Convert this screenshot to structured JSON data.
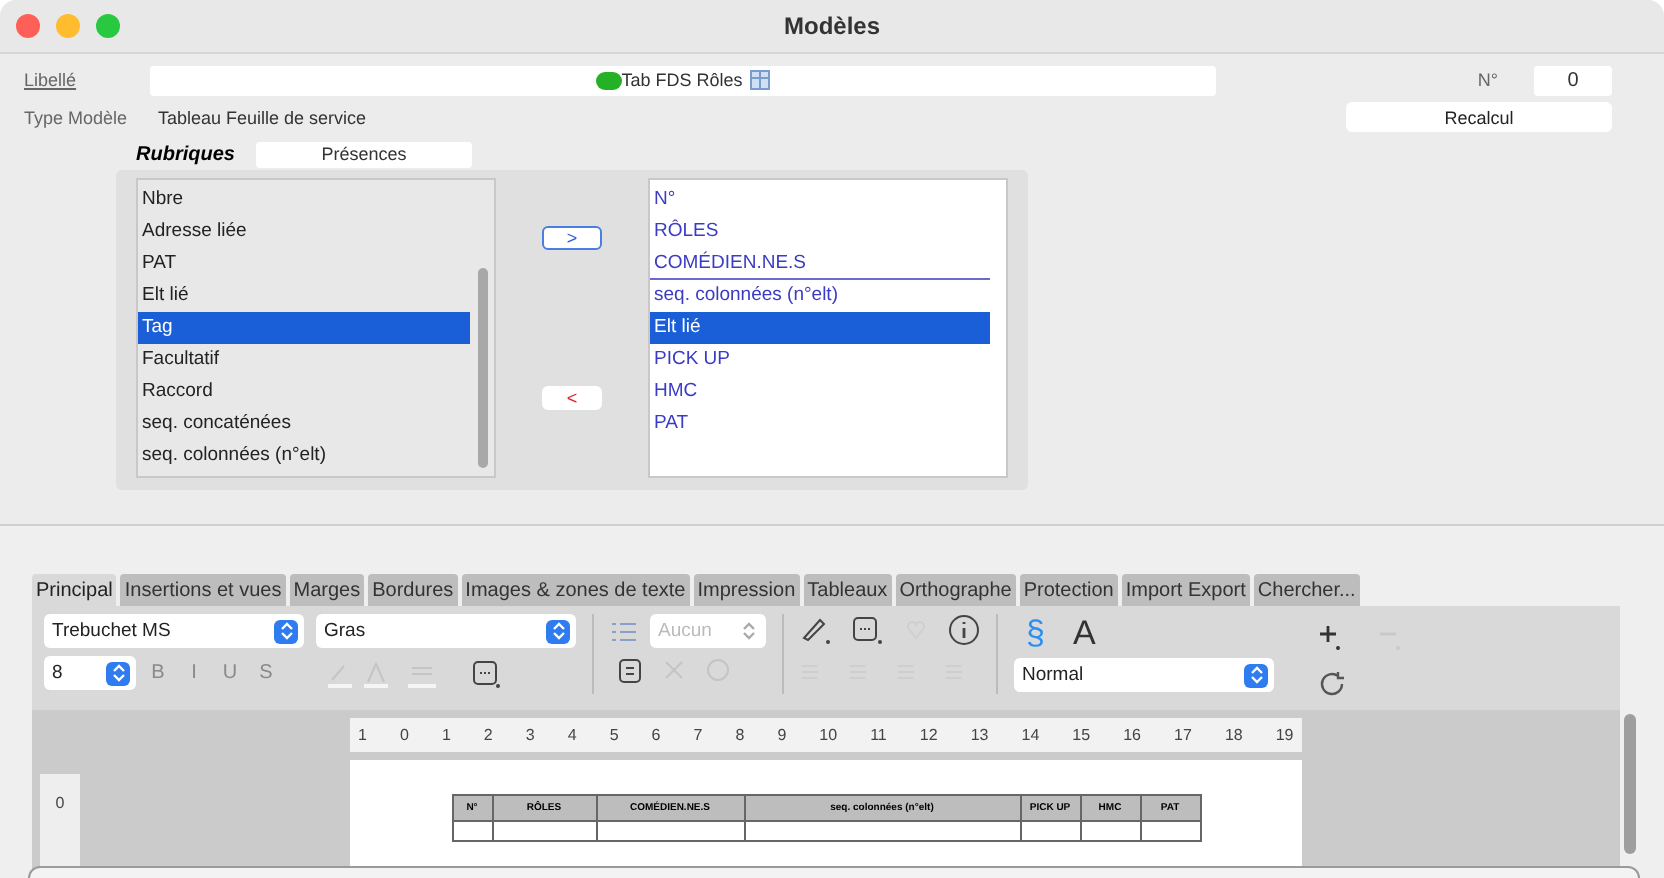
{
  "window": {
    "title": "Modèles"
  },
  "form": {
    "libelle_label": "Libellé",
    "libelle_value": "Tab FDS Rôles",
    "number_label": "N°",
    "number_value": "0",
    "type_label": "Type Modèle",
    "type_value": "Tableau Feuille de service",
    "recalc_button": "Recalcul"
  },
  "rubriques": {
    "label": "Rubriques",
    "field_value": "Présences",
    "available": [
      {
        "label": "Nbre",
        "selected": false
      },
      {
        "label": "Adresse liée",
        "selected": false
      },
      {
        "label": "PAT",
        "selected": false
      },
      {
        "label": "Elt lié",
        "selected": false
      },
      {
        "label": "Tag",
        "selected": true
      },
      {
        "label": "Facultatif",
        "selected": false
      },
      {
        "label": "Raccord",
        "selected": false
      },
      {
        "label": "seq. concaténées",
        "selected": false
      },
      {
        "label": "seq. colonnées (n°elt)",
        "selected": false
      }
    ],
    "add_button": ">",
    "remove_button": "<",
    "chosen": [
      {
        "label": "N°",
        "selected": false,
        "separator": false
      },
      {
        "label": "RÔLES",
        "selected": false,
        "separator": false
      },
      {
        "label": "COMÉDIEN.NE.S",
        "selected": false,
        "separator": true
      },
      {
        "label": "seq. colonnées (n°elt)",
        "selected": false,
        "separator": false
      },
      {
        "label": "Elt lié",
        "selected": true,
        "separator": false
      },
      {
        "label": "PICK UP",
        "selected": false,
        "separator": false
      },
      {
        "label": "HMC",
        "selected": false,
        "separator": false
      },
      {
        "label": "PAT",
        "selected": false,
        "separator": false
      }
    ]
  },
  "tabs": [
    {
      "label": "Principal",
      "selected": true
    },
    {
      "label": "Insertions et vues",
      "selected": false
    },
    {
      "label": "Marges",
      "selected": false
    },
    {
      "label": "Bordures",
      "selected": false
    },
    {
      "label": "Images & zones de texte",
      "selected": false
    },
    {
      "label": "Impression",
      "selected": false
    },
    {
      "label": "Tableaux",
      "selected": false
    },
    {
      "label": "Orthographe",
      "selected": false
    },
    {
      "label": "Protection",
      "selected": false
    },
    {
      "label": "Import Export",
      "selected": false
    },
    {
      "label": "Chercher...",
      "selected": false
    }
  ],
  "toolbar": {
    "font": "Trebuchet MS",
    "weight": "Gras",
    "size": "8",
    "list_style": "Aucun",
    "paragraph_style": "Normal",
    "section_sign": "§",
    "char_style": "A",
    "format_letters": [
      {
        "label": "B",
        "disabled": true
      },
      {
        "label": "I",
        "disabled": true
      },
      {
        "label": "U",
        "disabled": true
      },
      {
        "label": "S",
        "disabled": true
      }
    ]
  },
  "ruler": {
    "labels": [
      "1",
      "0",
      "1",
      "2",
      "3",
      "4",
      "5",
      "6",
      "7",
      "8",
      "9",
      "10",
      "11",
      "12",
      "13",
      "14",
      "15",
      "16",
      "17",
      "18",
      "19"
    ],
    "vertical_label": "0"
  },
  "document_table": {
    "columns": [
      "N°",
      "RÔLES",
      "COMÉDIEN.NE.S",
      "seq. colonnées (n°elt)",
      "PICK UP",
      "HMC",
      "PAT"
    ]
  }
}
